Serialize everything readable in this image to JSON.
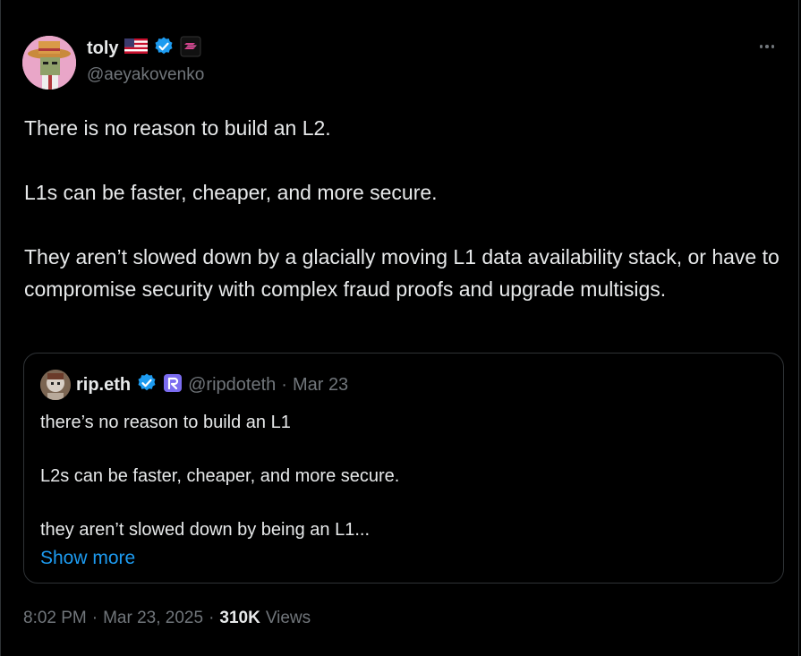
{
  "author": {
    "display_name": "toly",
    "handle": "@aeyakovenko",
    "flag_icon": "us-flag-icon",
    "verified_color": "#1d9bf0",
    "badge_color": "#c63c86"
  },
  "tweet": {
    "paragraphs": [
      "There is no reason to build an L2.",
      "L1s can be faster, cheaper, and more secure.",
      "They aren’t slowed down by a glacially moving L1 data availability stack, or have to compromise security with complex fraud proofs and upgrade multisigs."
    ]
  },
  "quote": {
    "display_name": "rip.eth",
    "handle": "@ripdoteth",
    "separator": "·",
    "date": "Mar 23",
    "paragraphs": [
      "there’s no reason to build an L1",
      "L2s can be faster, cheaper, and more secure.",
      "they aren’t slowed down by being an L1..."
    ],
    "show_more": "Show more",
    "badge_color": "#7b6cf0"
  },
  "meta": {
    "time": "8:02 PM",
    "sep1": "·",
    "date": "Mar 23, 2025",
    "sep2": "·",
    "views_count": "310K",
    "views_label": "Views"
  }
}
